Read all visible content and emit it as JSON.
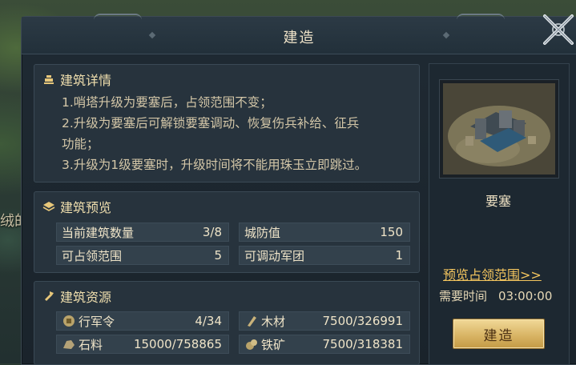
{
  "map": {
    "partial_label": "绒的"
  },
  "dialog": {
    "title": "建造",
    "close_icon": "close-x-icon"
  },
  "details": {
    "header": "建筑详情",
    "icon": "building-icon",
    "lines": [
      "1.哨塔升级为要塞后，占领范围不变；",
      "2.升级为要塞后可解锁要塞调动、恢复伤兵补给、征兵",
      "功能；",
      "3.升级为1级要塞时，升级时间将不能用珠玉立即跳过。"
    ]
  },
  "preview": {
    "header": "建筑预览",
    "icon": "layers-icon",
    "stats": [
      {
        "label": "当前建筑数量",
        "value": "3/8"
      },
      {
        "label": "城防值",
        "value": "150"
      },
      {
        "label": "可占领范围",
        "value": "5"
      },
      {
        "label": "可调动军团",
        "value": "1"
      }
    ]
  },
  "resources": {
    "header": "建筑资源",
    "icon": "hammer-icon",
    "items": [
      {
        "name": "行军令",
        "icon": "march-order-icon",
        "value": "4/34"
      },
      {
        "name": "木材",
        "icon": "wood-icon",
        "value": "7500/326991"
      },
      {
        "name": "石料",
        "icon": "stone-icon",
        "value": "15000/758865"
      },
      {
        "name": "铁矿",
        "icon": "iron-ore-icon",
        "value": "7500/318381"
      }
    ]
  },
  "building": {
    "name": "要塞",
    "image_icon": "fortress-image",
    "preview_link": "预览占领范围>>",
    "time_label": "需要时间",
    "time_value": "03:00:00",
    "build_button": "建造"
  },
  "colors": {
    "gold_text": "#f3c55e",
    "button_gold": "#d9b566",
    "panel_bg": "#27333d"
  }
}
